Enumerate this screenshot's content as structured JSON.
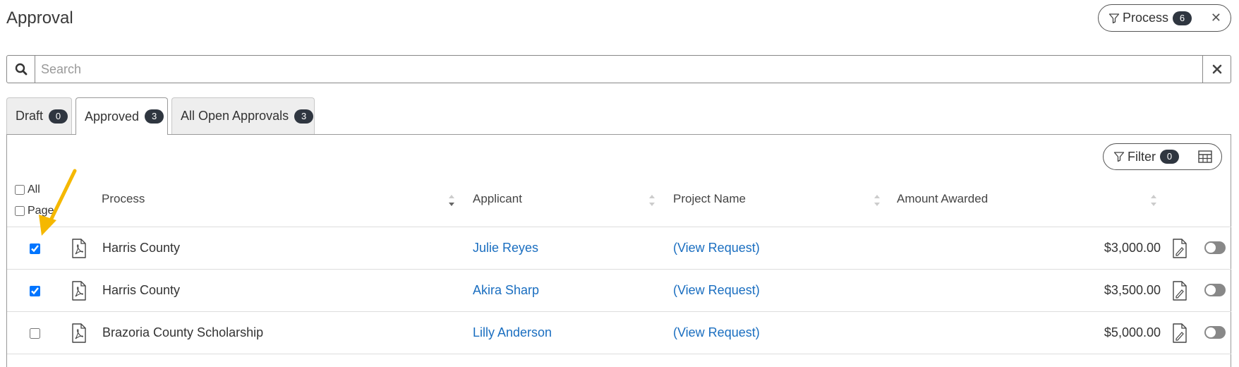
{
  "page": {
    "title": "Approval"
  },
  "process_filter": {
    "label": "Process",
    "count": "6",
    "close": "✕"
  },
  "search": {
    "placeholder": "Search",
    "value": ""
  },
  "tabs": [
    {
      "label": "Draft",
      "count": "0",
      "active": false
    },
    {
      "label": "Approved",
      "count": "3",
      "active": true
    },
    {
      "label": "All Open Approvals",
      "count": "3",
      "active": false
    }
  ],
  "toolbar": {
    "filter_label": "Filter",
    "filter_count": "0"
  },
  "selection": {
    "all_label": "All",
    "page_label": "Page"
  },
  "columns": {
    "process": "Process",
    "applicant": "Applicant",
    "project": "Project Name",
    "amount": "Amount Awarded"
  },
  "rows": [
    {
      "checked": true,
      "process": "Harris County",
      "applicant": "Julie Reyes",
      "project": "(View Request)",
      "amount": "$3,000.00"
    },
    {
      "checked": true,
      "process": "Harris County",
      "applicant": "Akira Sharp",
      "project": "(View Request)",
      "amount": "$3,500.00"
    },
    {
      "checked": false,
      "process": "Brazoria County Scholarship",
      "applicant": "Lilly Anderson",
      "project": "(View Request)",
      "amount": "$5,000.00"
    }
  ],
  "colors": {
    "link": "#1a6ec0",
    "badge": "#2f3640",
    "annotation_arrow": "#f5b800"
  }
}
